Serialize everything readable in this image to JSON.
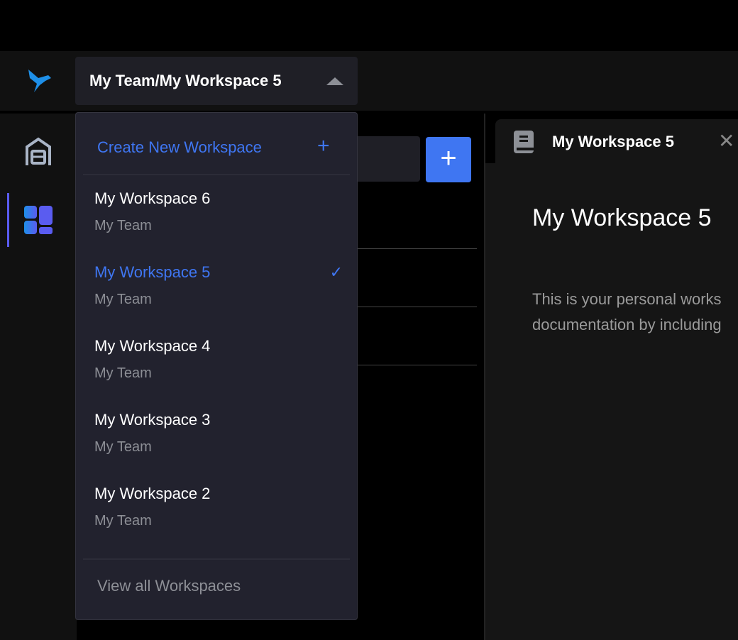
{
  "header": {
    "workspace_selector": "My Team/My Workspace 5"
  },
  "dropdown": {
    "create_label": "Create New Workspace",
    "items": [
      {
        "name": "My Workspace 6",
        "team": "My Team",
        "selected": false
      },
      {
        "name": "My Workspace 5",
        "team": "My Team",
        "selected": true
      },
      {
        "name": "My Workspace 4",
        "team": "My Team",
        "selected": false
      },
      {
        "name": "My Workspace 3",
        "team": "My Team",
        "selected": false
      },
      {
        "name": "My Workspace 2",
        "team": "My Team",
        "selected": false
      }
    ],
    "view_all_label": "View all Workspaces"
  },
  "tab": {
    "title": "My Workspace 5"
  },
  "doc": {
    "title": "My Workspace 5",
    "body_line1": "This is your personal works",
    "body_line2": "documentation by including"
  },
  "colors": {
    "accent": "#3f76f2",
    "background": "#000000",
    "panel": "#22222e"
  }
}
